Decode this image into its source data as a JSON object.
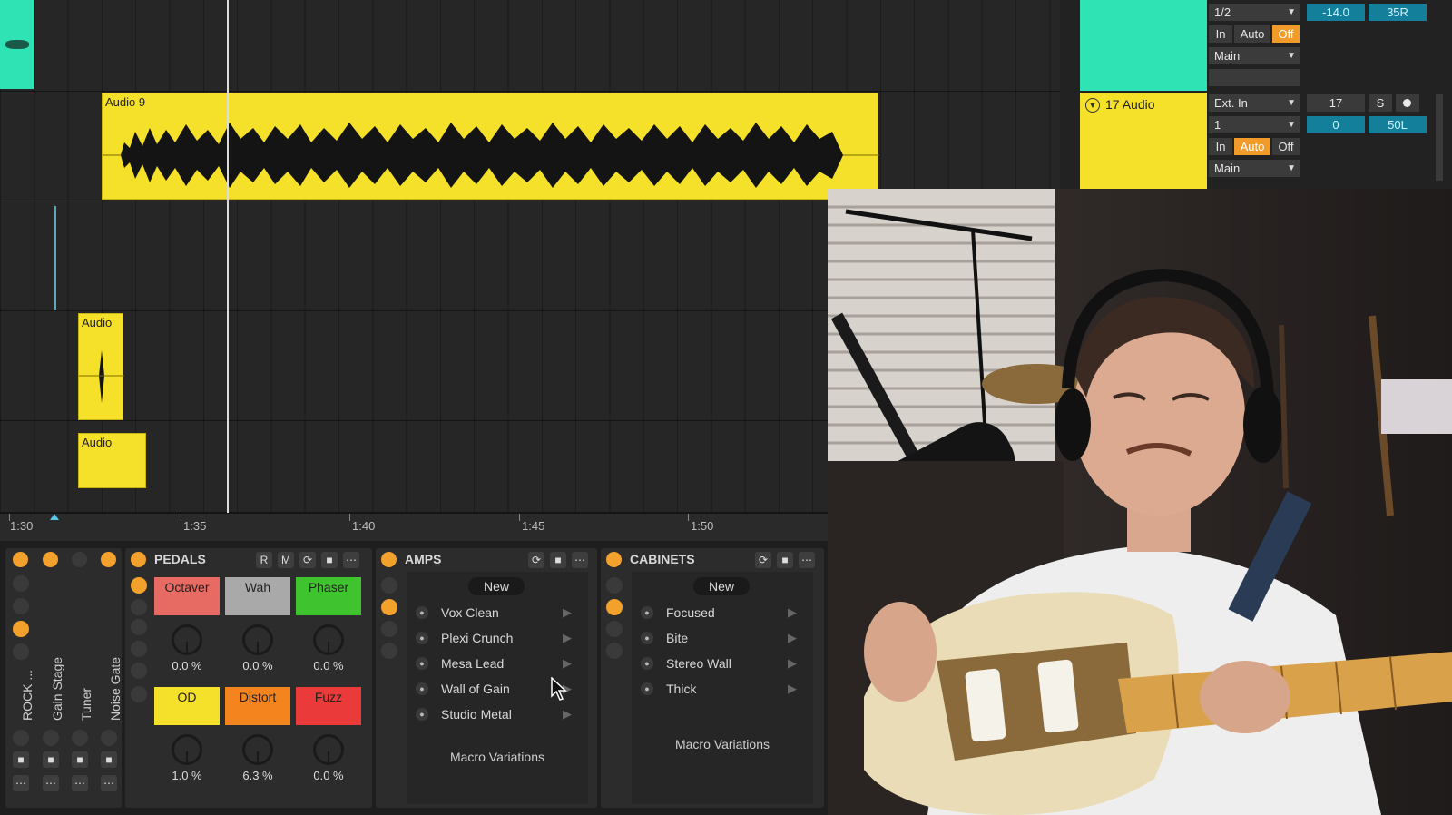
{
  "arrangement": {
    "clips": {
      "audio9": "Audio 9",
      "audio_a": "Audio",
      "audio_b": "Audio"
    },
    "ruler_ticks": [
      "1:30",
      "1:35",
      "1:40",
      "1:45",
      "1:50"
    ]
  },
  "mixer": {
    "track1": {
      "input_channel": "1/2",
      "volume": "-14.0",
      "pan": "35R",
      "monitor_in": "In",
      "monitor_auto": "Auto",
      "monitor_off": "Off",
      "output": "Main"
    },
    "track2": {
      "name": "17 Audio",
      "input_type": "Ext. In",
      "track_number": "17",
      "solo": "S",
      "input_channel": "1",
      "volume": "0",
      "pan": "50L",
      "monitor_in": "In",
      "monitor_auto": "Auto",
      "monitor_off": "Off",
      "output": "Main"
    }
  },
  "rack": {
    "chains": [
      "ROCK ...",
      "Gain Stage",
      "Tuner",
      "Noise Gate"
    ],
    "pedals": {
      "title": "PEDALS",
      "r": "R",
      "m": "M",
      "items": [
        {
          "name": "Octaver",
          "value": "0.0 %",
          "color": "#e86b63"
        },
        {
          "name": "Wah",
          "value": "0.0 %",
          "color": "#a9a9a9"
        },
        {
          "name": "Phaser",
          "value": "0.0 %",
          "color": "#3fc42f"
        },
        {
          "name": "OD",
          "value": "1.0 %",
          "color": "#f5e02a"
        },
        {
          "name": "Distort",
          "value": "6.3 %",
          "color": "#f4851e"
        },
        {
          "name": "Fuzz",
          "value": "0.0 %",
          "color": "#ea3a3a"
        }
      ]
    },
    "amps": {
      "title": "AMPS",
      "new_label": "New",
      "presets": [
        "Vox Clean",
        "Plexi Crunch",
        "Mesa Lead",
        "Wall of Gain",
        "Studio Metal"
      ],
      "macro_label": "Macro Variations"
    },
    "cabinets": {
      "title": "CABINETS",
      "new_label": "New",
      "presets": [
        "Focused",
        "Bite",
        "Stereo Wall",
        "Thick"
      ],
      "macro_label": "Macro Variations"
    }
  }
}
